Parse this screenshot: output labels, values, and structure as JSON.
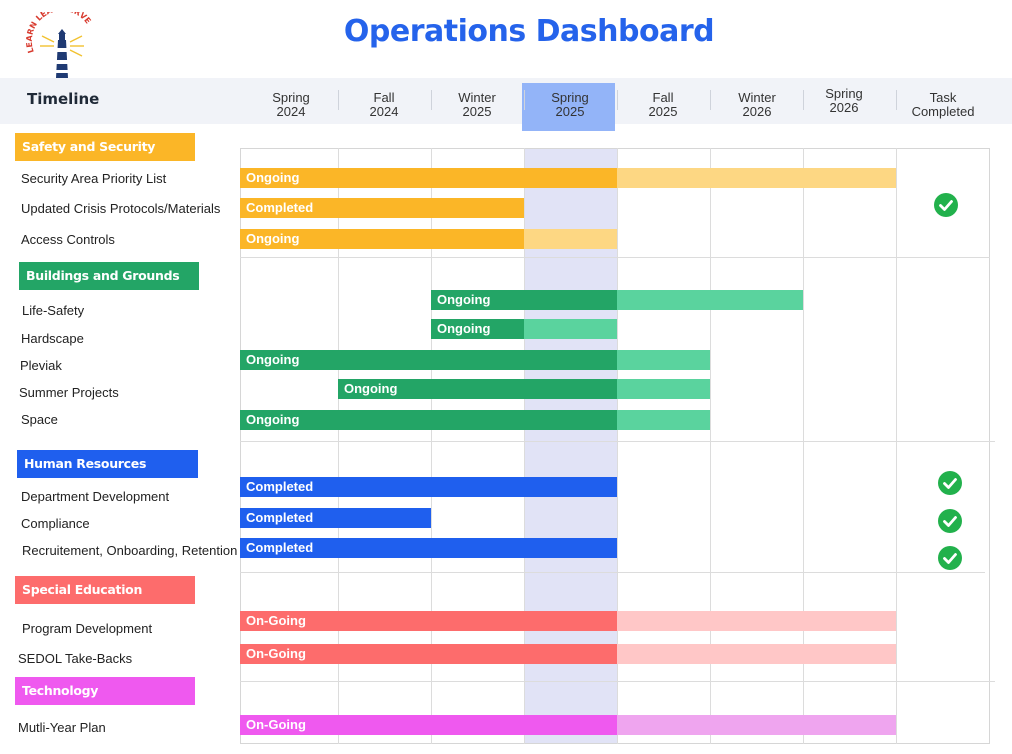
{
  "header": {
    "title": "Operations Dashboard",
    "logo_text": "LEARN LEAD SERVE",
    "timeline_label": "Timeline"
  },
  "colors": {
    "safety": "#fbb627",
    "safety_light": "#fdd783",
    "buildings": "#23a566",
    "buildings_light": "#5ad39e",
    "hr": "#1f5fee",
    "hr_light": "#1f5fee",
    "sped": "#fd6c6c",
    "sped_light": "#ffc7c7",
    "tech": "#ef59ef",
    "tech_light": "#efa5ef",
    "check": "#22b14c",
    "highlight": "#93b4f8",
    "title": "#2563eb"
  },
  "chart_data": {
    "type": "gantt",
    "title": "Operations Dashboard",
    "periods": [
      "Spring\n2024",
      "Fall\n2024",
      "Winter\n2025",
      "Spring\n2025",
      "Fall\n2025",
      "Winter\n2026",
      "Spring\n2026",
      "Task\nCompleted"
    ],
    "current_period": "Spring 2025",
    "categories": [
      {
        "name": "Safety and Security",
        "color_key": "safety",
        "tasks": [
          {
            "name": "Security Area Priority List",
            "status": "Ongoing",
            "start": 0.0,
            "done": 4.0,
            "planned": 7.0,
            "completed": false
          },
          {
            "name": "Updated Crisis Protocols/Materials",
            "status": "Completed",
            "start": 0.0,
            "done": 3.0,
            "planned": 3.0,
            "completed": true
          },
          {
            "name": "Access Controls",
            "status": "Ongoing",
            "start": 0.0,
            "done": 3.0,
            "planned": 4.0,
            "completed": false
          }
        ]
      },
      {
        "name": "Buildings and Grounds",
        "color_key": "buildings",
        "tasks": [
          {
            "name": "Life-Safety",
            "status": "Ongoing",
            "start": 2.0,
            "done": 4.0,
            "planned": 6.0,
            "completed": false
          },
          {
            "name": "Hardscape",
            "status": "Ongoing",
            "start": 2.0,
            "done": 3.0,
            "planned": 4.0,
            "completed": false
          },
          {
            "name": "Pleviak",
            "status": "Ongoing",
            "start": 0.0,
            "done": 4.0,
            "planned": 5.0,
            "completed": false
          },
          {
            "name": "Summer Projects",
            "status": "Ongoing",
            "start": 1.0,
            "done": 4.0,
            "planned": 5.0,
            "completed": false
          },
          {
            "name": "Space",
            "status": "Ongoing",
            "start": 0.0,
            "done": 4.0,
            "planned": 5.0,
            "completed": false
          }
        ]
      },
      {
        "name": "Human Resources",
        "color_key": "hr",
        "tasks": [
          {
            "name": "Department Development",
            "status": "Completed",
            "start": 0.0,
            "done": 4.0,
            "planned": 4.0,
            "completed": true
          },
          {
            "name": "Compliance",
            "status": "Completed",
            "start": 0.0,
            "done": 2.0,
            "planned": 2.0,
            "completed": true
          },
          {
            "name": "Recruitement, Onboarding, Retention",
            "status": "Completed",
            "start": 0.0,
            "done": 4.0,
            "planned": 4.0,
            "completed": true
          }
        ]
      },
      {
        "name": "Special Education",
        "color_key": "sped",
        "tasks": [
          {
            "name": "Program Development",
            "status": "On-Going",
            "start": 0.0,
            "done": 4.0,
            "planned": 7.0,
            "completed": false
          },
          {
            "name": "SEDOL Take-Backs",
            "status": "On-Going",
            "start": 0.0,
            "done": 4.0,
            "planned": 7.0,
            "completed": false
          }
        ]
      },
      {
        "name": "Technology",
        "color_key": "tech",
        "tasks": [
          {
            "name": "Mutli-Year Plan",
            "status": "On-Going",
            "start": 0.0,
            "done": 4.0,
            "planned": 7.0,
            "completed": false
          }
        ]
      }
    ]
  }
}
